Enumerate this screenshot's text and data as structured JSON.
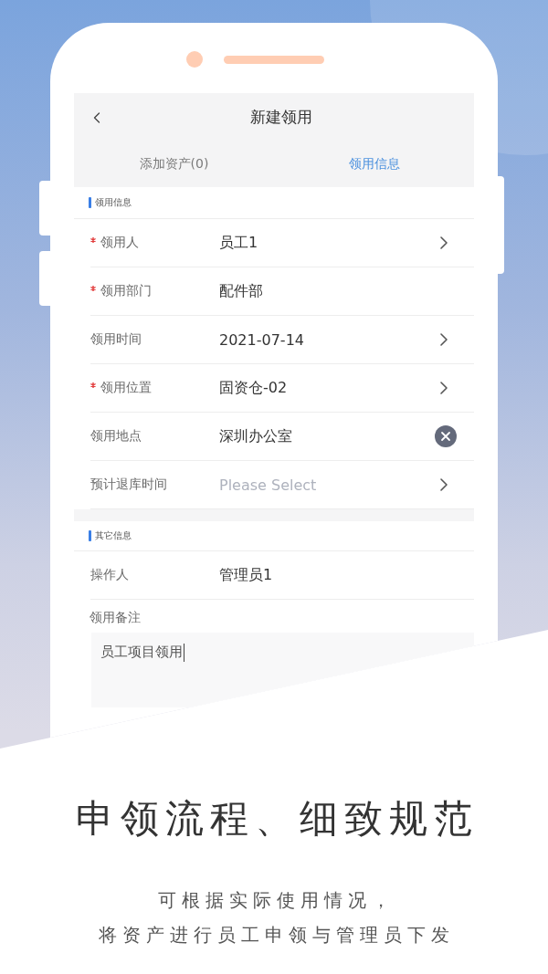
{
  "screen": {
    "title": "新建领用",
    "tabs": [
      {
        "label": "添加资产(0)",
        "selected": false
      },
      {
        "label": "领用信息",
        "selected": true
      }
    ],
    "sections": [
      {
        "title": "领用信息",
        "fields": [
          {
            "kind": "picker",
            "label": "领用人",
            "required": true,
            "value": "员工1"
          },
          {
            "kind": "static",
            "label": "领用部门",
            "required": true,
            "value": "配件部"
          },
          {
            "kind": "picker",
            "label": "领用时间",
            "required": false,
            "value": "2021-07-14"
          },
          {
            "kind": "picker",
            "label": "领用位置",
            "required": true,
            "value": "固资仓-02"
          },
          {
            "kind": "clearable",
            "label": "领用地点",
            "required": false,
            "value": "深圳办公室"
          },
          {
            "kind": "picker",
            "label": "预计退库时间",
            "required": false,
            "placeholder": "Please Select"
          }
        ]
      },
      {
        "title": "其它信息",
        "fields": [
          {
            "kind": "static",
            "label": "操作人",
            "required": false,
            "value": "管理员1"
          },
          {
            "kind": "textarea",
            "label": "领用备注",
            "required": false,
            "value": "员工项目领用",
            "focused": true
          }
        ]
      }
    ]
  },
  "caption": {
    "heading": "申领流程、细致规范",
    "lines": [
      "可根据实际使用情况，",
      "将资产进行员工申领与管理员下发"
    ]
  }
}
